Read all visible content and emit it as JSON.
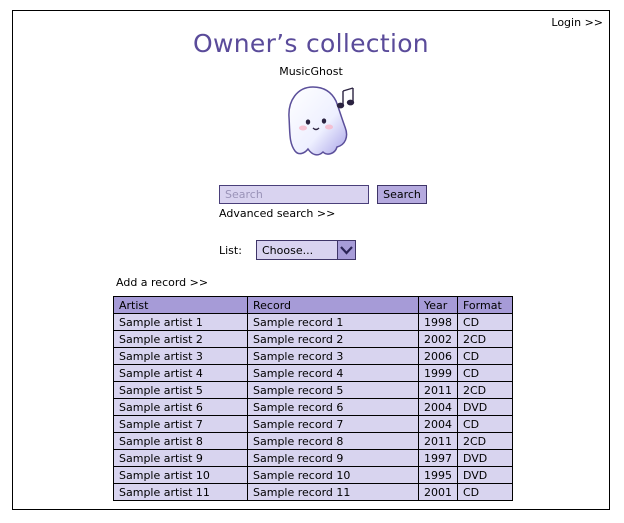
{
  "header": {
    "login_label": "Login >>"
  },
  "page": {
    "title": "Owner’s collection",
    "subtitle": "MusicGhost"
  },
  "search": {
    "placeholder": "Search",
    "button_label": "Search",
    "advanced_label": "Advanced search >>"
  },
  "list": {
    "label": "List:",
    "selected": "Choose..."
  },
  "add_record_label": "Add a record >>",
  "table": {
    "headers": [
      "Artist",
      "Record",
      "Year",
      "Format"
    ],
    "rows": [
      [
        "Sample artist 1",
        "Sample record 1",
        "1998",
        "CD"
      ],
      [
        "Sample artist 2",
        "Sample record 2",
        "2002",
        "2CD"
      ],
      [
        "Sample artist 3",
        "Sample record 3",
        "2006",
        "CD"
      ],
      [
        "Sample artist 4",
        "Sample record 4",
        "1999",
        "CD"
      ],
      [
        "Sample artist 5",
        "Sample record 5",
        "2011",
        "2CD"
      ],
      [
        "Sample artist 6",
        "Sample record 6",
        "2004",
        "DVD"
      ],
      [
        "Sample artist 7",
        "Sample record 7",
        "2004",
        "CD"
      ],
      [
        "Sample artist 8",
        "Sample record 8",
        "2011",
        "2CD"
      ],
      [
        "Sample artist 9",
        "Sample record 9",
        "1997",
        "DVD"
      ],
      [
        "Sample artist 10",
        "Sample record 10",
        "1995",
        "DVD"
      ],
      [
        "Sample artist 11",
        "Sample record 11",
        "2001",
        "CD"
      ]
    ]
  },
  "colors": {
    "title": "#5a4b9a",
    "header_bg": "#a69bd7",
    "row_bg": "#d8d4ef",
    "input_bg": "#d9d3f0"
  }
}
